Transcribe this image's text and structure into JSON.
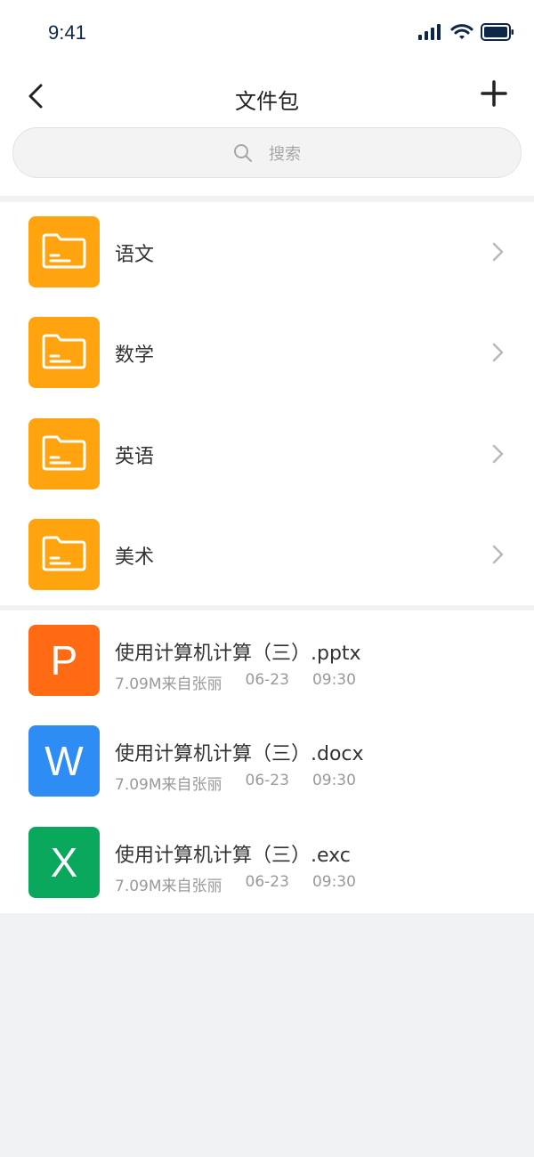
{
  "status_bar": {
    "time": "9:41"
  },
  "nav": {
    "title": "文件包"
  },
  "search": {
    "placeholder": "搜索"
  },
  "folders": [
    {
      "name": "语文"
    },
    {
      "name": "数学"
    },
    {
      "name": "英语"
    },
    {
      "name": "美术"
    }
  ],
  "files": [
    {
      "letter": "P",
      "color": "#ff6a13",
      "name": "使用计算机计算（三）.pptx",
      "size_source": "7.09M来自张丽",
      "date": "06-23",
      "time": "09:30"
    },
    {
      "letter": "W",
      "color": "#2e8cf5",
      "name": "使用计算机计算（三）.docx",
      "size_source": "7.09M来自张丽",
      "date": "06-23",
      "time": "09:30"
    },
    {
      "letter": "X",
      "color": "#0aa85c",
      "name": "使用计算机计算（三）.exc",
      "size_source": "7.09M来自张丽",
      "date": "06-23",
      "time": "09:30"
    }
  ],
  "colors": {
    "folder": "#ffa30f",
    "background": "#f1f2f4"
  }
}
